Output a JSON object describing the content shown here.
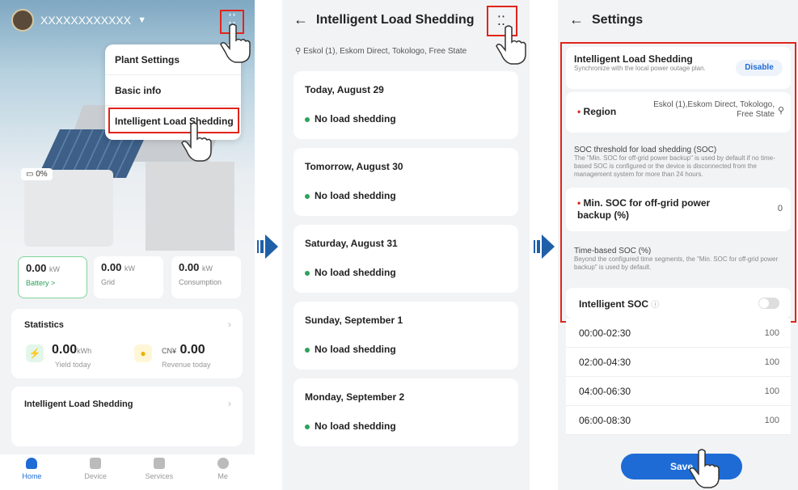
{
  "panel1": {
    "plant_name": "XXXXXXXXXXXX",
    "menu": [
      "Plant Settings",
      "Basic info",
      "Intelligent Load Shedding"
    ],
    "battery_pct": "0%",
    "stats": [
      {
        "value": "0.00",
        "unit": "kW",
        "label": "Battery >"
      },
      {
        "value": "0.00",
        "unit": "kW",
        "label": "Grid"
      },
      {
        "value": "0.00",
        "unit": "kW",
        "label": "Consumption"
      }
    ],
    "statistics": {
      "title": "Statistics",
      "yield_value": "0.00",
      "yield_unit": "kWh",
      "yield_label": "Yield today",
      "revenue_prefix": "CN¥",
      "revenue_value": "0.00",
      "revenue_label": "Revenue today"
    },
    "ils_card": "Intelligent Load Shedding",
    "tabs": [
      "Home",
      "Device",
      "Services",
      "Me"
    ]
  },
  "panel2": {
    "title": "Intelligent Load Shedding",
    "location": "Eskol (1), Eskom Direct, Tokologo, Free State",
    "days": [
      {
        "date": "Today, August 29",
        "status": "No load shedding"
      },
      {
        "date": "Tomorrow, August 30",
        "status": "No load shedding"
      },
      {
        "date": "Saturday, August 31",
        "status": "No load shedding"
      },
      {
        "date": "Sunday, September 1",
        "status": "No load shedding"
      },
      {
        "date": "Monday, September 2",
        "status": "No load shedding"
      }
    ]
  },
  "panel3": {
    "title": "Settings",
    "ils_title": "Intelligent Load Shedding",
    "ils_desc": "Synchronize with the local power outage plan.",
    "disable_label": "Disable",
    "region_label": "Region",
    "region_value": "Eskol (1),Eskom Direct, Tokologo, Free State",
    "soc_title": "SOC threshold for load shedding (SOC)",
    "soc_desc": "The \"Min. SOC for off-grid power backup\" is used by default if no time-based SOC is configured or the device is disconnected from the management system for more than 24 hours.",
    "min_soc_label": "Min. SOC for off-grid power backup (%)",
    "min_soc_value": "0",
    "timebased_title": "Time-based SOC (%)",
    "timebased_desc": "Beyond the configured time segments, the \"Min. SOC for off-grid power backup\" is used by default.",
    "intelligent_soc": "Intelligent SOC",
    "info_glyph": "ⓘ",
    "rows": [
      {
        "time": "00:00-02:30",
        "value": "100"
      },
      {
        "time": "02:00-04:30",
        "value": "100"
      },
      {
        "time": "04:00-06:30",
        "value": "100"
      },
      {
        "time": "06:00-08:30",
        "value": "100"
      }
    ],
    "save_label": "Save"
  },
  "colors": {
    "accent": "#1e6bd6",
    "highlight": "#e1251b",
    "ok": "#2aa35a"
  }
}
